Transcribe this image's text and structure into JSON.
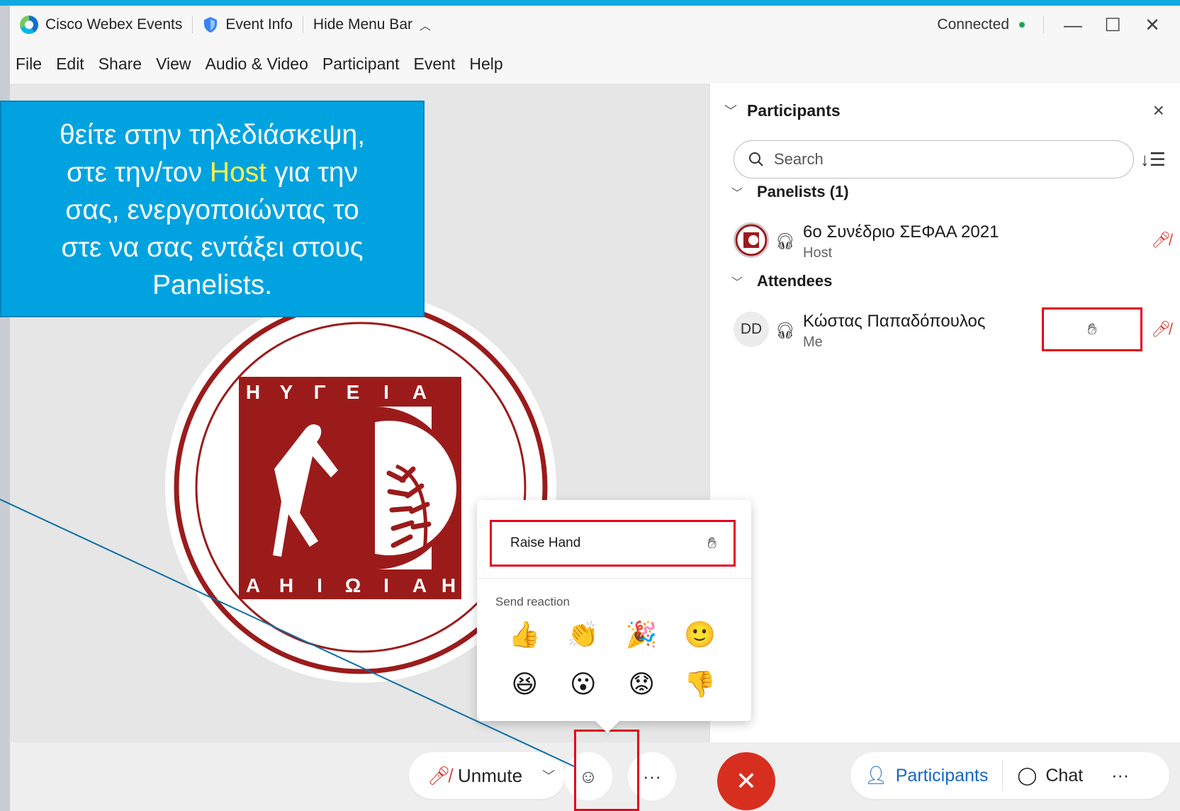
{
  "titlebar": {
    "app_name": "Cisco Webex Events",
    "event_info": "Event Info",
    "hide_menu": "Hide Menu Bar",
    "status": "Connected"
  },
  "menu": [
    "File",
    "Edit",
    "Share",
    "View",
    "Audio & Video",
    "Participant",
    "Event",
    "Help"
  ],
  "callout": {
    "line1": "θείτε στην τηλεδιάσκεψη,",
    "line2_pre": "στε την/τον ",
    "line2_host": "Host",
    "line2_post": " για την",
    "line3": "σας, ενεργοποιώντας το",
    "line4": "στε να σας εντάξει στους",
    "line5": "Panelists."
  },
  "logo": {
    "letters_top": [
      "Η",
      "Υ",
      "Γ",
      "Ε",
      "Ι",
      "Α"
    ],
    "letters_bottom": [
      "Α",
      "Η",
      "Ι",
      "Ω",
      "Ι",
      "Α",
      "Η"
    ]
  },
  "participants_panel": {
    "title": "Participants",
    "search_placeholder": "Search",
    "panelists_header": "Panelists (1)",
    "attendees_header": "Attendees",
    "panelist": {
      "name": "6ο Συνέδριο ΣΕΦΑΑ 2021",
      "role": "Host"
    },
    "attendee": {
      "name": "Κώστας Παπαδόπουλος",
      "role": "Me",
      "initials": "DD"
    }
  },
  "reaction_popup": {
    "raise_hand": "Raise Hand",
    "send_reaction": "Send reaction",
    "emojis": [
      "👍",
      "👏",
      "🎉",
      "🙂",
      "😆",
      "😮",
      "😟",
      "👎"
    ]
  },
  "bottom_bar": {
    "unmute": "Unmute",
    "more": "···",
    "participants": "Participants",
    "chat": "Chat",
    "more_right": "···"
  },
  "colors": {
    "accent_blue": "#00a3e0",
    "highlight_red": "#e4041d",
    "leave_red": "#d72f1f",
    "logo_red": "#9b1b1b",
    "host_yellow": "#fff04c"
  }
}
